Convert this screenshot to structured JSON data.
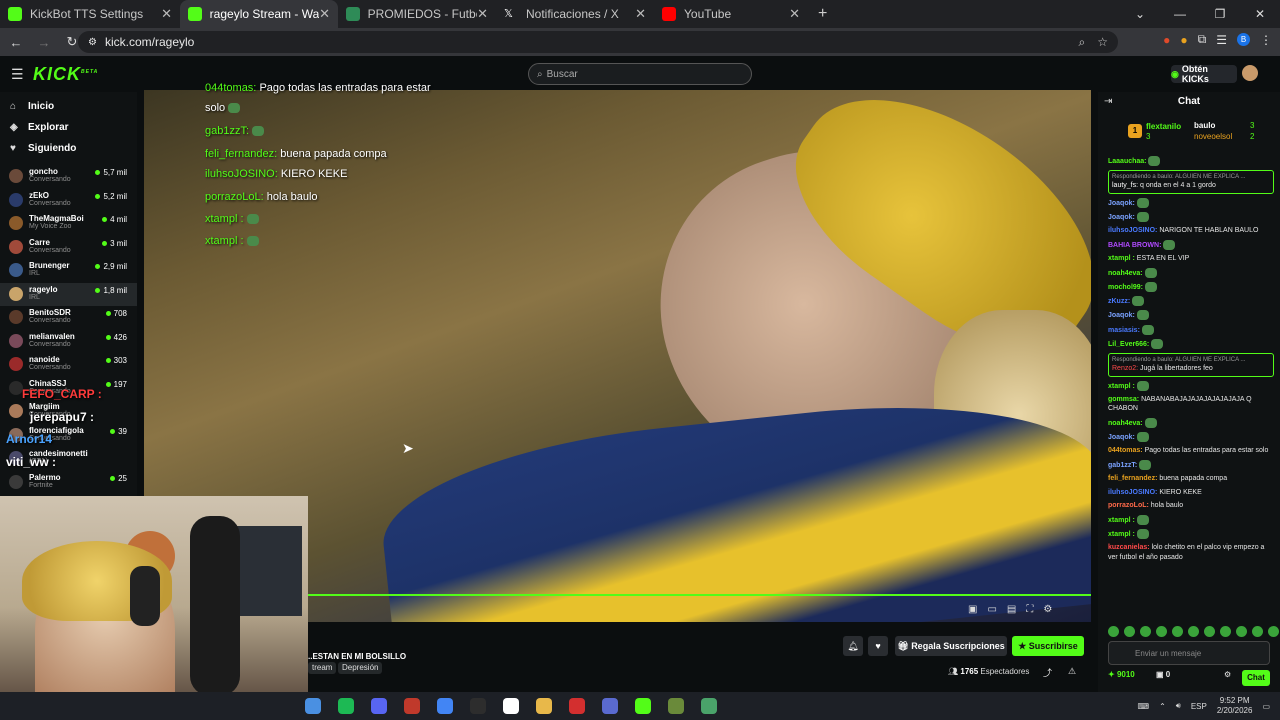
{
  "browser": {
    "tabs": [
      {
        "title": "KickBot TTS Settings",
        "color": "#53fc18"
      },
      {
        "title": "rageylo Stream - Watch Liv",
        "color": "#53fc18"
      },
      {
        "title": "PROMIEDOS - Futbol Argentin",
        "color": "#2e8b57"
      },
      {
        "title": "Notificaciones / X",
        "color": "#ffffff"
      },
      {
        "title": "YouTube",
        "color": "#ff0000"
      }
    ],
    "url": "kick.com/rageylo"
  },
  "kick": {
    "logo": "KICK",
    "logo_sup": "BETA",
    "search_placeholder": "Buscar",
    "obtain": "Obtén KICKs"
  },
  "sidebar": {
    "nav": [
      {
        "label": "Inicio",
        "icon": "home-icon"
      },
      {
        "label": "Explorar",
        "icon": "compass-icon"
      },
      {
        "label": "Siguiendo",
        "icon": "heart-icon"
      }
    ],
    "channels": [
      {
        "name": "goncho",
        "category": "Conversando",
        "viewers": "5,7 mil",
        "color": "#6a4a3a"
      },
      {
        "name": "zEkO",
        "category": "Conversando",
        "viewers": "5,2 mil",
        "color": "#2a3b6a"
      },
      {
        "name": "TheMagmaBoi",
        "category": "My Voice Zoo",
        "viewers": "4 mil",
        "color": "#8a5a2a"
      },
      {
        "name": "Carre",
        "category": "Conversando",
        "viewers": "3 mil",
        "color": "#a04a3a"
      },
      {
        "name": "Brunenger",
        "category": "IRL",
        "viewers": "2,9 mil",
        "color": "#3a5a8a"
      },
      {
        "name": "rageylo",
        "category": "IRL",
        "viewers": "1,8 mil",
        "color": "#c9a46a"
      },
      {
        "name": "BenitoSDR",
        "category": "Conversando",
        "viewers": "708",
        "color": "#5a3a2a"
      },
      {
        "name": "melianvalen",
        "category": "Conversando",
        "viewers": "426",
        "color": "#7a4a5a"
      },
      {
        "name": "nanoide",
        "category": "Conversando",
        "viewers": "303",
        "color": "#9a2a2a"
      },
      {
        "name": "ChinaSSJ",
        "category": "Conversando",
        "viewers": "197",
        "color": "#2a2a2a"
      },
      {
        "name": "Margiim",
        "category": "Conversando",
        "viewers": "",
        "color": "#aa7a5a"
      },
      {
        "name": "florenciafigola",
        "category": "Conversando",
        "viewers": "39",
        "color": "#8a6a5a"
      },
      {
        "name": "candesimonetti",
        "category": "(GTA)",
        "viewers": "",
        "color": "#4a4a6a"
      },
      {
        "name": "Palermo",
        "category": "Fortnite",
        "viewers": "25",
        "color": "#3a3a3a"
      }
    ]
  },
  "stream": {
    "overlay_chat": [
      {
        "user": "044tomas:",
        "text": "Pago todas las entradas para estar"
      },
      {
        "user": "",
        "text": "solo"
      },
      {
        "user": "gab1zzT:",
        "text": ""
      },
      {
        "user": "feli_fernandez:",
        "text": "buena papada compa"
      },
      {
        "user": "iluhsoJOSINO:",
        "text": "KIERO KEKE"
      },
      {
        "user": "porrazoLoL:",
        "text": "hola baulo"
      },
      {
        "user": "xtampl :",
        "text": ""
      },
      {
        "user": "xtampl :",
        "text": ""
      }
    ],
    "cam_overlay": [
      {
        "text": "FEFO_CARP :",
        "color": "#ff3b3b"
      },
      {
        "text": "jerepapu7 :",
        "color": "#ffffff"
      },
      {
        "text": "Arnor14",
        "color": "#4aa3ff"
      },
      {
        "text": "viti_ww :",
        "color": "#ffffff"
      }
    ],
    "title": "..ESTAN EN MI BOLSILLO",
    "tags": [
      "tream",
      "Depresión"
    ],
    "gift_label": "Regala Suscripciones",
    "subscribe_label": "Suscribirse",
    "viewers_count": "1765",
    "viewers_label": "Espectadores"
  },
  "chat": {
    "header": "Chat",
    "pinned": {
      "badge": "1",
      "leader": "flextanilo",
      "leader_count": "3",
      "entries": [
        {
          "name": "baulo",
          "count": "3"
        },
        {
          "name": "noveoelsol",
          "count": "2"
        }
      ]
    },
    "messages": [
      {
        "user": "Laaauchaa:",
        "text": "",
        "color": "#53fc18",
        "reply": ""
      },
      {
        "user": "lauty_fs:",
        "text": "q onda en el 4 a 1 gordo",
        "color": "#ffffff",
        "reply": "Respondiendo a baulo: ALGUIEN ME EXPLICA ..."
      },
      {
        "user": "Joaqok:",
        "text": "",
        "color": "#7aa2ff",
        "reply": ""
      },
      {
        "user": "Joaqok:",
        "text": "",
        "color": "#7aa2ff",
        "reply": ""
      },
      {
        "user": "iluhsoJOSINO:",
        "text": "NARIGON TE HABLAN BAULO",
        "color": "#4a7aff",
        "reply": ""
      },
      {
        "user": "BAHIA BROWN:",
        "text": "",
        "color": "#b04aff",
        "reply": ""
      },
      {
        "user": "xtampl :",
        "text": "ESTA EN EL VIP",
        "color": "#53fc18",
        "reply": ""
      },
      {
        "user": "noah4eva:",
        "text": "",
        "color": "#53fc18",
        "reply": ""
      },
      {
        "user": "mochol99:",
        "text": "",
        "color": "#53fc18",
        "reply": ""
      },
      {
        "user": "zKuzz:",
        "text": "",
        "color": "#4a7aff",
        "reply": ""
      },
      {
        "user": "Joaqok:",
        "text": "",
        "color": "#7aa2ff",
        "reply": ""
      },
      {
        "user": "masiasis:",
        "text": "",
        "color": "#4a7aff",
        "reply": ""
      },
      {
        "user": "Lil_Ever666:",
        "text": "",
        "color": "#53fc18",
        "reply": ""
      },
      {
        "user": "Renzo2:",
        "text": "Jugá la libertadores feo",
        "color": "#ff4a4a",
        "reply": "Respondiendo a baulo: ALGUIEN ME EXPLICA ..."
      },
      {
        "user": "xtampl :",
        "text": "",
        "color": "#53fc18",
        "reply": ""
      },
      {
        "user": "gommsa:",
        "text": "NABANABAJAJAJAJAJAJAJAJA Q CHABON",
        "color": "#53fc18",
        "reply": ""
      },
      {
        "user": "noah4eva:",
        "text": "",
        "color": "#53fc18",
        "reply": ""
      },
      {
        "user": "Joaqok:",
        "text": "",
        "color": "#7aa2ff",
        "reply": ""
      },
      {
        "user": "044tomas:",
        "text": "Pago todas las entradas para estar solo",
        "color": "#e9a21f",
        "reply": ""
      },
      {
        "user": "gab1zzT:",
        "text": "",
        "color": "#7aa2ff",
        "reply": ""
      },
      {
        "user": "feli_fernandez:",
        "text": "buena papada compa",
        "color": "#e9a21f",
        "reply": ""
      },
      {
        "user": "iluhsoJOSINO:",
        "text": "KIERO KEKE",
        "color": "#4a7aff",
        "reply": ""
      },
      {
        "user": "porrazoLoL:",
        "text": "hola baulo",
        "color": "#ff6a4a",
        "reply": ""
      },
      {
        "user": "xtampl :",
        "text": "",
        "color": "#53fc18",
        "reply": ""
      },
      {
        "user": "xtampl :",
        "text": "",
        "color": "#53fc18",
        "reply": ""
      },
      {
        "user": "kuzcanielas:",
        "text": "lolo chetito en el palco vip empezo a ver futbol el año pasado",
        "color": "#ff4a4a",
        "reply": ""
      }
    ],
    "input_placeholder": "Enviar un mensaje",
    "kicks": "9010",
    "zero": "0",
    "chat_button": "Chat"
  },
  "taskbar": {
    "lang": "ESP",
    "time": "9:52 PM",
    "date": "2/20/2026"
  }
}
